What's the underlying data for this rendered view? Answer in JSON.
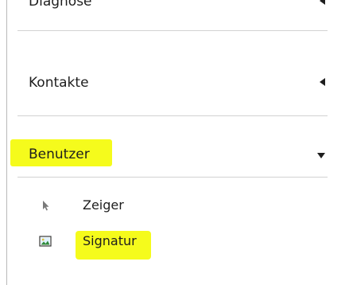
{
  "panel": {
    "sections": [
      {
        "label": "Diagnose",
        "arrow": "collapsed-left-arrow"
      },
      {
        "label": "Kontakte",
        "arrow": "collapsed-left-arrow"
      },
      {
        "label": "Benutzer",
        "arrow": "expanded-down-arrow"
      }
    ],
    "benutzer_items": [
      {
        "label": "Zeiger",
        "icon": "pointer-arrow-icon"
      },
      {
        "label": "Signatur",
        "icon": "image-icon"
      }
    ]
  },
  "colors": {
    "highlight": "#f5fb1c",
    "text": "#1e1e1e",
    "separator": "#d2d2d2",
    "border": "#b8b8b8"
  }
}
